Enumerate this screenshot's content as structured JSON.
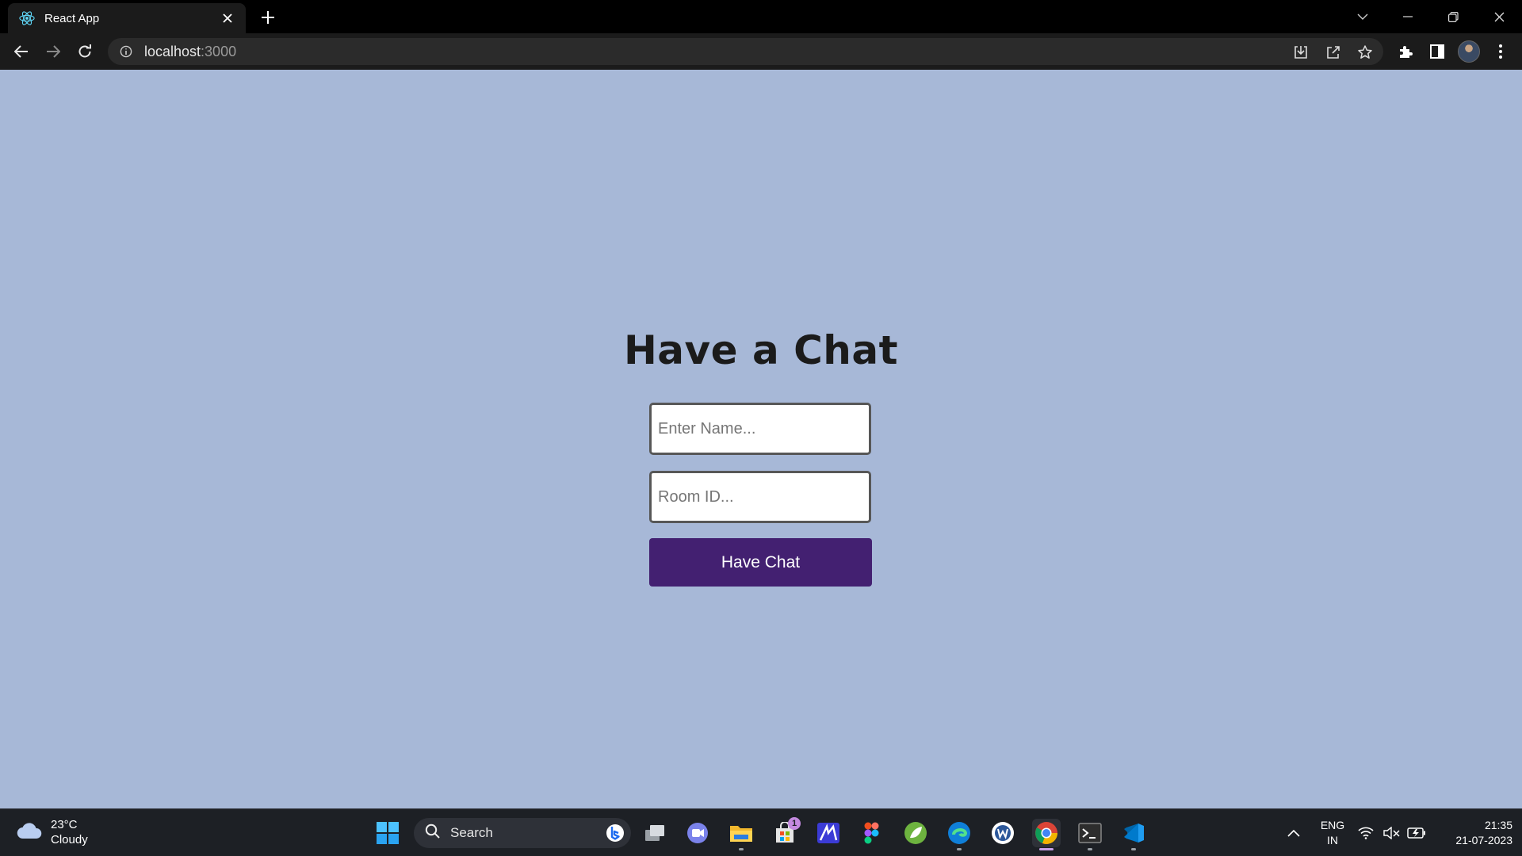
{
  "browser": {
    "tab_title": "React App",
    "url_host": "localhost",
    "url_port": ":3000"
  },
  "page": {
    "title": "Have a Chat",
    "name_placeholder": "Enter Name...",
    "room_placeholder": "Room ID...",
    "button_label": "Have Chat",
    "colors": {
      "background": "#a7b8d7",
      "button": "#432071",
      "title": "#1b1b1b"
    }
  },
  "taskbar": {
    "weather_temp": "23°C",
    "weather_desc": "Cloudy",
    "search_label": "Search",
    "store_badge": "1",
    "lang_primary": "ENG",
    "lang_region": "IN",
    "time": "21:35",
    "date": "21-07-2023"
  }
}
